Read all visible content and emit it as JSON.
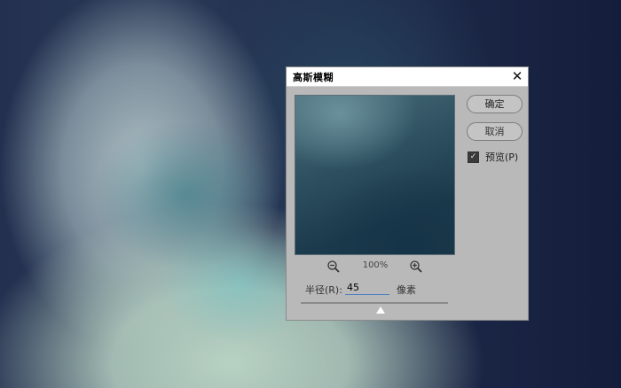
{
  "dialog": {
    "title": "高斯模糊",
    "close_glyph": "✕",
    "ok_label": "确定",
    "cancel_label": "取消",
    "preview_checkbox": {
      "label": "预览(P)",
      "checked": true,
      "check_glyph": "✓"
    },
    "zoom": {
      "level": "100%"
    },
    "radius": {
      "label": "半径(R):",
      "value": "45",
      "unit": "像素",
      "slider_fraction": 0.54
    }
  }
}
